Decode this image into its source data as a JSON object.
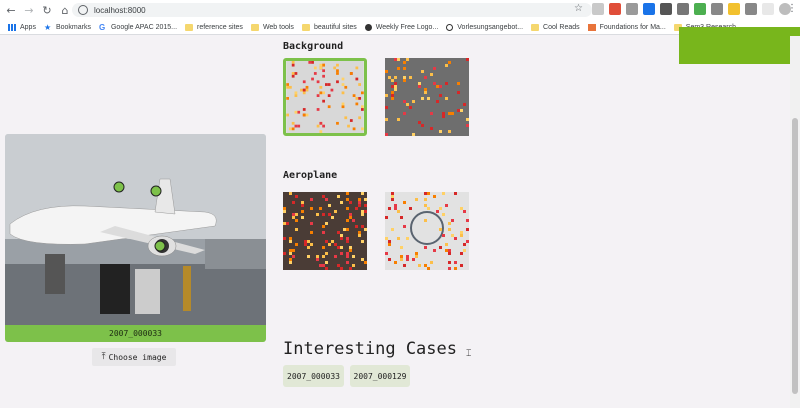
{
  "browser": {
    "url": "localhost:8000",
    "bookmarks": [
      {
        "label": "Apps",
        "icon": "apps-grid-icon"
      },
      {
        "label": "Bookmarks",
        "icon": "star-icon"
      },
      {
        "label": "Google APAC 2015...",
        "icon": "google-icon"
      },
      {
        "label": "reference sites",
        "icon": "folder-icon"
      },
      {
        "label": "Web tools",
        "icon": "folder-icon"
      },
      {
        "label": "beautiful sites",
        "icon": "folder-icon"
      },
      {
        "label": "Weekly Free Logo...",
        "icon": "site-icon"
      },
      {
        "label": "Vorlesungsangebot...",
        "icon": "site-icon"
      },
      {
        "label": "Cool Reads",
        "icon": "folder-icon"
      },
      {
        "label": "Foundations for Ma...",
        "icon": "site-icon"
      },
      {
        "label": "Sem3 Research",
        "icon": "folder-icon"
      }
    ]
  },
  "left_panel": {
    "image_caption": "2007_000033",
    "choose_button": "Choose image"
  },
  "sections": [
    {
      "title": "Background"
    },
    {
      "title": "Aeroplane"
    }
  ],
  "interesting": {
    "title": "Interesting Cases",
    "cases": [
      "2007_000033",
      "2007_000129"
    ]
  },
  "colors": {
    "accent": "#78b61c",
    "caption_bar": "#7dc14a",
    "case_button": "#e1e8d6"
  }
}
